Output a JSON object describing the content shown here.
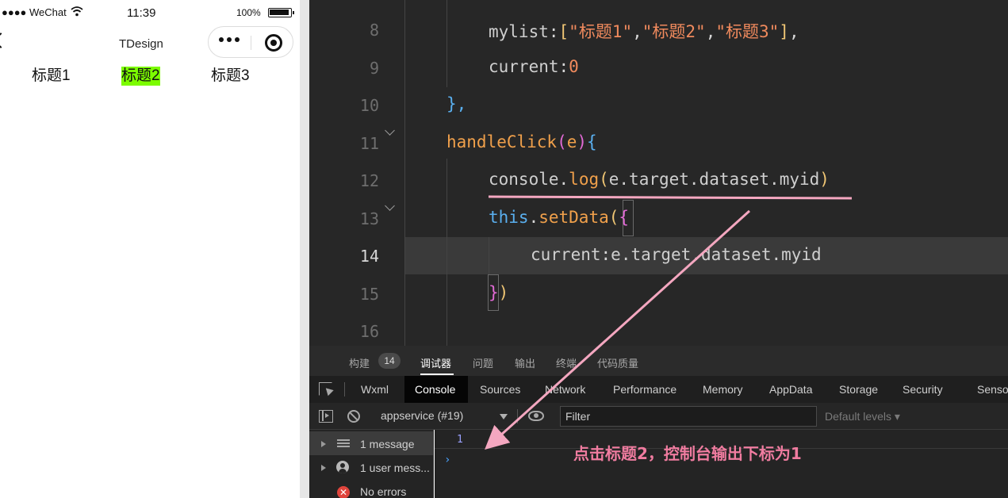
{
  "status_bar": {
    "carrier": "●●●● WeChat",
    "wifi_icon": "wifi-icon",
    "time": "11:39",
    "battery": "100%"
  },
  "nav_bar": {
    "title": "TDesign",
    "capsule_more_icon": "more-dots-icon",
    "capsule_close_icon": "record-close-icon"
  },
  "page_tabs": {
    "items": [
      "标题1",
      "标题2",
      "标题3"
    ],
    "active_index": 1,
    "active_color": "#7cfc00"
  },
  "editor": {
    "line_numbers": [
      "8",
      "9",
      "10",
      "11",
      "12",
      "13",
      "14",
      "15",
      "16"
    ],
    "active_line": "14",
    "code": {
      "l8": {
        "key": "mylist",
        "colon": ":",
        "open": "[",
        "s1": "\"标题1\"",
        "s2": "\"标题2\"",
        "s3": "\"标题3\"",
        "comma": ",",
        "close": "]",
        "end": ","
      },
      "l9": {
        "key": "current",
        "colon": ":",
        "value": "0"
      },
      "l10": {
        "text": "},"
      },
      "l11": {
        "fn": "handleClick",
        "open": "(",
        "param": "e",
        "close": ")",
        "brace": "{"
      },
      "l12": {
        "obj": "console",
        "dot": ".",
        "method": "log",
        "open": "(",
        "arg": "e.target.dataset.myid",
        "close": ")"
      },
      "l13": {
        "this": "this",
        "dot": ".",
        "method": "setData",
        "open": "(",
        "brace": "{"
      },
      "l14": {
        "key": "current",
        "colon": ":",
        "value": "e.target.dataset.myid"
      },
      "l15": {
        "brace": "}",
        "close": ")"
      }
    }
  },
  "panel_tabs": {
    "items": [
      "构建",
      "调试器",
      "问题",
      "输出",
      "终端",
      "代码质量"
    ],
    "build_badge": "14",
    "active": "调试器"
  },
  "devtools_tabs": {
    "inspect_icon": "element-picker-icon",
    "items": [
      "Wxml",
      "Console",
      "Sources",
      "Network",
      "Performance",
      "Memory",
      "AppData",
      "Storage",
      "Security",
      "Sensor"
    ],
    "active": "Console"
  },
  "console_toolbar": {
    "sidebar_icon": "sidebar-toggle-icon",
    "clear_icon": "clear-console-icon",
    "context": "appservice (#19)",
    "eye_icon": "eye-icon",
    "filter_placeholder": "Filter",
    "levels": "Default levels ▾"
  },
  "console_sidebar": {
    "items": [
      {
        "label": "1 message",
        "icon": "list-icon"
      },
      {
        "label": "1 user mess...",
        "icon": "user-icon"
      },
      {
        "label": "No errors",
        "icon": "error-icon"
      }
    ]
  },
  "console_output": {
    "log_value": "1",
    "prompt": "›"
  },
  "annotation": {
    "text": "点击标题2，控制台输出下标为1",
    "color": "#f4a7c0"
  }
}
